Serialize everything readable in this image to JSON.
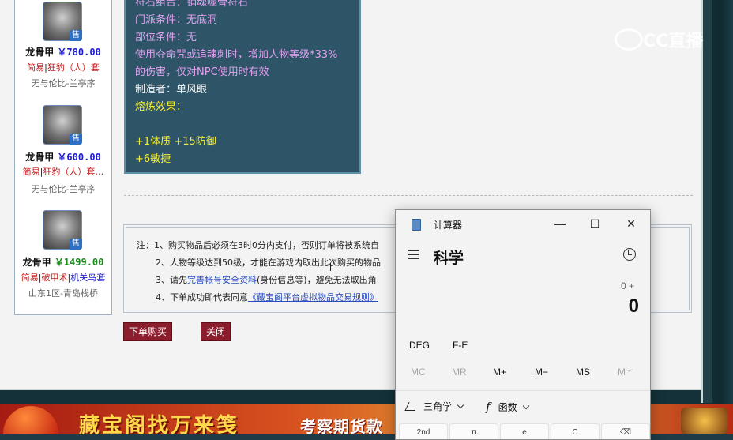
{
  "sidebar": {
    "items": [
      {
        "name": "龙骨甲",
        "price": "￥780.00",
        "tags": [
          "简易",
          "狂豹（人）套"
        ],
        "location": "无与伦比-兰亭序",
        "badge": "售"
      },
      {
        "name": "龙骨甲",
        "price": "￥600.00",
        "tags": [
          "简易",
          "狂豹（人）套…"
        ],
        "location": "无与伦比-兰亭序",
        "badge": "售"
      },
      {
        "name": "龙骨甲",
        "price": "￥1499.00",
        "tags": [
          "简易",
          "破甲术",
          "机关鸟套"
        ],
        "location": "山东1区-青岛栈桥",
        "badge": "售"
      }
    ]
  },
  "tooltip": {
    "lines": [
      {
        "text": "符石组合：销魂噬骨符石",
        "color": "pink"
      },
      {
        "text": "门派条件：无底洞",
        "color": "pink"
      },
      {
        "text": "部位条件：无",
        "color": "pink"
      },
      {
        "text": "使用夺命咒或追魂刺时，增加人物等级*33%",
        "color": "pink"
      },
      {
        "text": "的伤害，仅对NPC使用时有效",
        "color": "pink"
      },
      {
        "text": "制造者：单风眼",
        "color": "white"
      },
      {
        "text": "熔炼效果：",
        "color": "yellow"
      },
      {
        "text": "",
        "color": "yellow"
      },
      {
        "text": "+1体质 +15防御",
        "color": "yellow"
      },
      {
        "text": "+6敏捷",
        "color": "yellow"
      }
    ]
  },
  "notes": {
    "line1": "注：1、购买物品后必须在3时0分内支付，否则订单将被系统自",
    "line2": "2、人物等级达到50级，才能在游戏内取出此次购买的物品",
    "line3_pre": "3、请先",
    "line3_link": "完善帐号安全资料",
    "line3_post": "(身份信息等)，避免无法取出角",
    "line4_pre": "4、下单成功即代表同意",
    "line4_link": "《藏宝阁平台虚拟物品交易规则》"
  },
  "buttons": {
    "buy": "下单购买",
    "close": "关闭"
  },
  "calculator": {
    "title": "计算器",
    "mode": "科学",
    "expression": "0 +",
    "display": "0",
    "minimize": "—",
    "maximize": "☐",
    "close": "✕",
    "angle_unit": "DEG",
    "fe": "F-E",
    "memory": [
      "MC",
      "MR",
      "M+",
      "M−",
      "MS",
      "M"
    ],
    "trig_label": "三角学",
    "func_label": "函数",
    "keys": [
      "2nd",
      "π",
      "e",
      "C",
      "⌫"
    ]
  },
  "banner": {
    "text": "藏宝阁找万来笺",
    "sub": "考察期货款"
  },
  "watermark": {
    "text": "CC直播"
  }
}
